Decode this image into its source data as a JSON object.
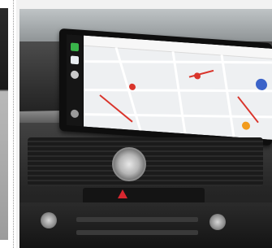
{
  "image": {
    "alt": "",
    "colors": {
      "map_background": "#eef0f2",
      "map_road": "#ffffff",
      "map_traffic_red": "#d9342b",
      "map_pin_blue": "#3b63c9",
      "hazard_red": "#d8272f",
      "rail_icons": [
        "#39b54a",
        "#e9eef2",
        "#c9c9c9",
        "#9a9a9a"
      ]
    },
    "icons": [
      "map-pin-icon",
      "hazard-icon",
      "navigation-fab-icon",
      "app-rail-icons"
    ]
  }
}
